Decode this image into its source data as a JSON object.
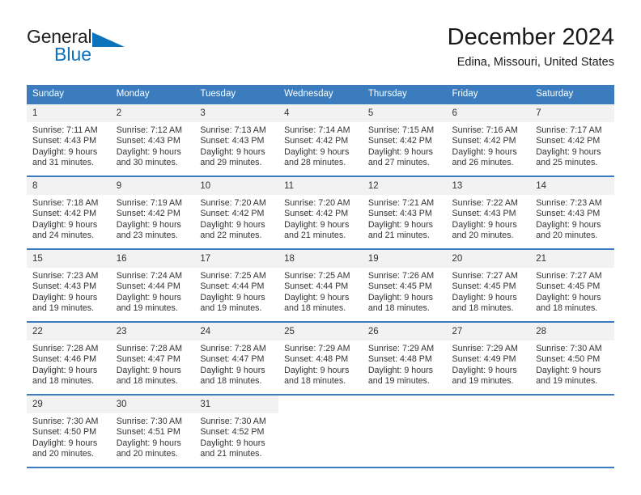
{
  "brand": {
    "name_part1": "General",
    "name_part2": "Blue",
    "triangle_color": "#0b72bb",
    "text_color": "#231f20"
  },
  "header": {
    "title": "December 2024",
    "subtitle": "Edina, Missouri, United States"
  },
  "theme": {
    "header_row_bg": "#3a7cbe",
    "header_row_text": "#ffffff",
    "daynum_bg": "#f2f2f2",
    "grid_line": "#3a7cbe",
    "body_text": "#333333"
  },
  "calendar": {
    "weekday_headers": [
      "Sunday",
      "Monday",
      "Tuesday",
      "Wednesday",
      "Thursday",
      "Friday",
      "Saturday"
    ],
    "weeks": [
      [
        {
          "day": "1",
          "sunrise": "Sunrise: 7:11 AM",
          "sunset": "Sunset: 4:43 PM",
          "daylight_line1": "Daylight: 9 hours",
          "daylight_line2": "and 31 minutes."
        },
        {
          "day": "2",
          "sunrise": "Sunrise: 7:12 AM",
          "sunset": "Sunset: 4:43 PM",
          "daylight_line1": "Daylight: 9 hours",
          "daylight_line2": "and 30 minutes."
        },
        {
          "day": "3",
          "sunrise": "Sunrise: 7:13 AM",
          "sunset": "Sunset: 4:43 PM",
          "daylight_line1": "Daylight: 9 hours",
          "daylight_line2": "and 29 minutes."
        },
        {
          "day": "4",
          "sunrise": "Sunrise: 7:14 AM",
          "sunset": "Sunset: 4:42 PM",
          "daylight_line1": "Daylight: 9 hours",
          "daylight_line2": "and 28 minutes."
        },
        {
          "day": "5",
          "sunrise": "Sunrise: 7:15 AM",
          "sunset": "Sunset: 4:42 PM",
          "daylight_line1": "Daylight: 9 hours",
          "daylight_line2": "and 27 minutes."
        },
        {
          "day": "6",
          "sunrise": "Sunrise: 7:16 AM",
          "sunset": "Sunset: 4:42 PM",
          "daylight_line1": "Daylight: 9 hours",
          "daylight_line2": "and 26 minutes."
        },
        {
          "day": "7",
          "sunrise": "Sunrise: 7:17 AM",
          "sunset": "Sunset: 4:42 PM",
          "daylight_line1": "Daylight: 9 hours",
          "daylight_line2": "and 25 minutes."
        }
      ],
      [
        {
          "day": "8",
          "sunrise": "Sunrise: 7:18 AM",
          "sunset": "Sunset: 4:42 PM",
          "daylight_line1": "Daylight: 9 hours",
          "daylight_line2": "and 24 minutes."
        },
        {
          "day": "9",
          "sunrise": "Sunrise: 7:19 AM",
          "sunset": "Sunset: 4:42 PM",
          "daylight_line1": "Daylight: 9 hours",
          "daylight_line2": "and 23 minutes."
        },
        {
          "day": "10",
          "sunrise": "Sunrise: 7:20 AM",
          "sunset": "Sunset: 4:42 PM",
          "daylight_line1": "Daylight: 9 hours",
          "daylight_line2": "and 22 minutes."
        },
        {
          "day": "11",
          "sunrise": "Sunrise: 7:20 AM",
          "sunset": "Sunset: 4:42 PM",
          "daylight_line1": "Daylight: 9 hours",
          "daylight_line2": "and 21 minutes."
        },
        {
          "day": "12",
          "sunrise": "Sunrise: 7:21 AM",
          "sunset": "Sunset: 4:43 PM",
          "daylight_line1": "Daylight: 9 hours",
          "daylight_line2": "and 21 minutes."
        },
        {
          "day": "13",
          "sunrise": "Sunrise: 7:22 AM",
          "sunset": "Sunset: 4:43 PM",
          "daylight_line1": "Daylight: 9 hours",
          "daylight_line2": "and 20 minutes."
        },
        {
          "day": "14",
          "sunrise": "Sunrise: 7:23 AM",
          "sunset": "Sunset: 4:43 PM",
          "daylight_line1": "Daylight: 9 hours",
          "daylight_line2": "and 20 minutes."
        }
      ],
      [
        {
          "day": "15",
          "sunrise": "Sunrise: 7:23 AM",
          "sunset": "Sunset: 4:43 PM",
          "daylight_line1": "Daylight: 9 hours",
          "daylight_line2": "and 19 minutes."
        },
        {
          "day": "16",
          "sunrise": "Sunrise: 7:24 AM",
          "sunset": "Sunset: 4:44 PM",
          "daylight_line1": "Daylight: 9 hours",
          "daylight_line2": "and 19 minutes."
        },
        {
          "day": "17",
          "sunrise": "Sunrise: 7:25 AM",
          "sunset": "Sunset: 4:44 PM",
          "daylight_line1": "Daylight: 9 hours",
          "daylight_line2": "and 19 minutes."
        },
        {
          "day": "18",
          "sunrise": "Sunrise: 7:25 AM",
          "sunset": "Sunset: 4:44 PM",
          "daylight_line1": "Daylight: 9 hours",
          "daylight_line2": "and 18 minutes."
        },
        {
          "day": "19",
          "sunrise": "Sunrise: 7:26 AM",
          "sunset": "Sunset: 4:45 PM",
          "daylight_line1": "Daylight: 9 hours",
          "daylight_line2": "and 18 minutes."
        },
        {
          "day": "20",
          "sunrise": "Sunrise: 7:27 AM",
          "sunset": "Sunset: 4:45 PM",
          "daylight_line1": "Daylight: 9 hours",
          "daylight_line2": "and 18 minutes."
        },
        {
          "day": "21",
          "sunrise": "Sunrise: 7:27 AM",
          "sunset": "Sunset: 4:45 PM",
          "daylight_line1": "Daylight: 9 hours",
          "daylight_line2": "and 18 minutes."
        }
      ],
      [
        {
          "day": "22",
          "sunrise": "Sunrise: 7:28 AM",
          "sunset": "Sunset: 4:46 PM",
          "daylight_line1": "Daylight: 9 hours",
          "daylight_line2": "and 18 minutes."
        },
        {
          "day": "23",
          "sunrise": "Sunrise: 7:28 AM",
          "sunset": "Sunset: 4:47 PM",
          "daylight_line1": "Daylight: 9 hours",
          "daylight_line2": "and 18 minutes."
        },
        {
          "day": "24",
          "sunrise": "Sunrise: 7:28 AM",
          "sunset": "Sunset: 4:47 PM",
          "daylight_line1": "Daylight: 9 hours",
          "daylight_line2": "and 18 minutes."
        },
        {
          "day": "25",
          "sunrise": "Sunrise: 7:29 AM",
          "sunset": "Sunset: 4:48 PM",
          "daylight_line1": "Daylight: 9 hours",
          "daylight_line2": "and 18 minutes."
        },
        {
          "day": "26",
          "sunrise": "Sunrise: 7:29 AM",
          "sunset": "Sunset: 4:48 PM",
          "daylight_line1": "Daylight: 9 hours",
          "daylight_line2": "and 19 minutes."
        },
        {
          "day": "27",
          "sunrise": "Sunrise: 7:29 AM",
          "sunset": "Sunset: 4:49 PM",
          "daylight_line1": "Daylight: 9 hours",
          "daylight_line2": "and 19 minutes."
        },
        {
          "day": "28",
          "sunrise": "Sunrise: 7:30 AM",
          "sunset": "Sunset: 4:50 PM",
          "daylight_line1": "Daylight: 9 hours",
          "daylight_line2": "and 19 minutes."
        }
      ],
      [
        {
          "day": "29",
          "sunrise": "Sunrise: 7:30 AM",
          "sunset": "Sunset: 4:50 PM",
          "daylight_line1": "Daylight: 9 hours",
          "daylight_line2": "and 20 minutes."
        },
        {
          "day": "30",
          "sunrise": "Sunrise: 7:30 AM",
          "sunset": "Sunset: 4:51 PM",
          "daylight_line1": "Daylight: 9 hours",
          "daylight_line2": "and 20 minutes."
        },
        {
          "day": "31",
          "sunrise": "Sunrise: 7:30 AM",
          "sunset": "Sunset: 4:52 PM",
          "daylight_line1": "Daylight: 9 hours",
          "daylight_line2": "and 21 minutes."
        },
        {
          "day": "",
          "sunrise": "",
          "sunset": "",
          "daylight_line1": "",
          "daylight_line2": ""
        },
        {
          "day": "",
          "sunrise": "",
          "sunset": "",
          "daylight_line1": "",
          "daylight_line2": ""
        },
        {
          "day": "",
          "sunrise": "",
          "sunset": "",
          "daylight_line1": "",
          "daylight_line2": ""
        },
        {
          "day": "",
          "sunrise": "",
          "sunset": "",
          "daylight_line1": "",
          "daylight_line2": ""
        }
      ]
    ]
  }
}
